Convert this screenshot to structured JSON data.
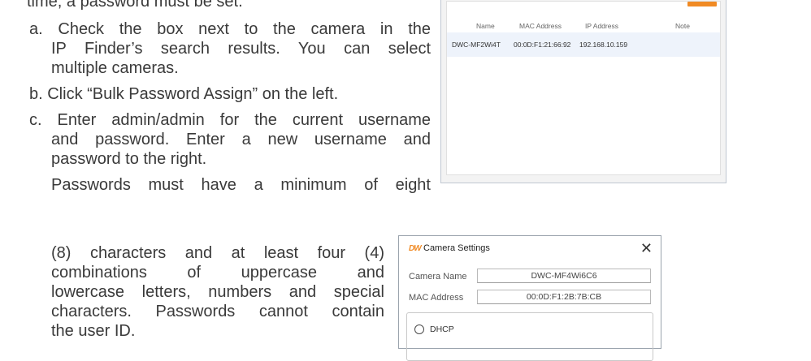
{
  "document": {
    "lines_left_top": [
      "time, a password must be set.",
      "a. Check the box next to the camera in the",
      "IP Finder’s search results. You can select",
      "multiple cameras.",
      "b. Click “Bulk Password Assign” on the left.",
      "c. Enter admin/admin for the current username",
      "and password. Enter a new username and",
      "password to the right.",
      "Passwords must have a minimum of eight"
    ],
    "lines_left_bottom": [
      "(8) characters and at least four (4)",
      "combinations of uppercase and",
      "lowercase letters, numbers and special",
      "characters. Passwords cannot contain",
      "the user ID."
    ]
  },
  "ip_finder": {
    "columns": [
      "Name",
      "MAC Address",
      "IP Address",
      "Note"
    ],
    "rows": [
      {
        "name": "DWC-MF2Wi4T",
        "mac": "00:0D:F1:21:66:92",
        "ip": "192.168.10.159",
        "note": ""
      }
    ],
    "colors": {
      "accent": "#f08a24",
      "row_highlight": "#eef3fb"
    }
  },
  "camera_settings": {
    "title": "Camera Settings",
    "logo_text": "DW",
    "close_glyph": "✕",
    "camera_name_label": "Camera Name",
    "camera_name_value": "DWC-MF4Wi6C6",
    "mac_label": "MAC Address",
    "mac_value": "00:0D:F1:2B:7B:CB",
    "dhcp_label": "DHCP"
  }
}
